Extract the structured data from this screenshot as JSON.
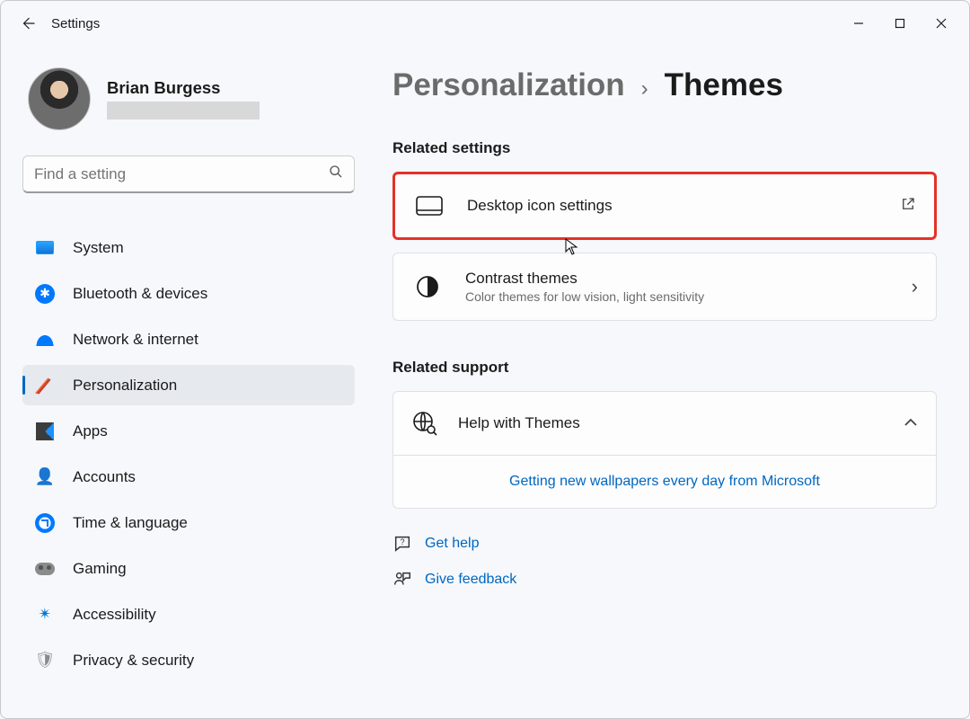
{
  "window": {
    "title": "Settings"
  },
  "profile": {
    "name": "Brian Burgess"
  },
  "search": {
    "placeholder": "Find a setting"
  },
  "sidebar": {
    "items": [
      {
        "label": "System"
      },
      {
        "label": "Bluetooth & devices"
      },
      {
        "label": "Network & internet"
      },
      {
        "label": "Personalization"
      },
      {
        "label": "Apps"
      },
      {
        "label": "Accounts"
      },
      {
        "label": "Time & language"
      },
      {
        "label": "Gaming"
      },
      {
        "label": "Accessibility"
      },
      {
        "label": "Privacy & security"
      }
    ]
  },
  "breadcrumb": {
    "parent": "Personalization",
    "sep": "›",
    "current": "Themes"
  },
  "sections": {
    "related_settings": "Related settings",
    "related_support": "Related support"
  },
  "cards": {
    "desktop_icons": {
      "title": "Desktop icon settings"
    },
    "contrast": {
      "title": "Contrast themes",
      "sub": "Color themes for low vision, light sensitivity"
    }
  },
  "support": {
    "title": "Help with Themes",
    "link": "Getting new wallpapers every day from Microsoft"
  },
  "footer": {
    "help": "Get help",
    "feedback": "Give feedback"
  }
}
